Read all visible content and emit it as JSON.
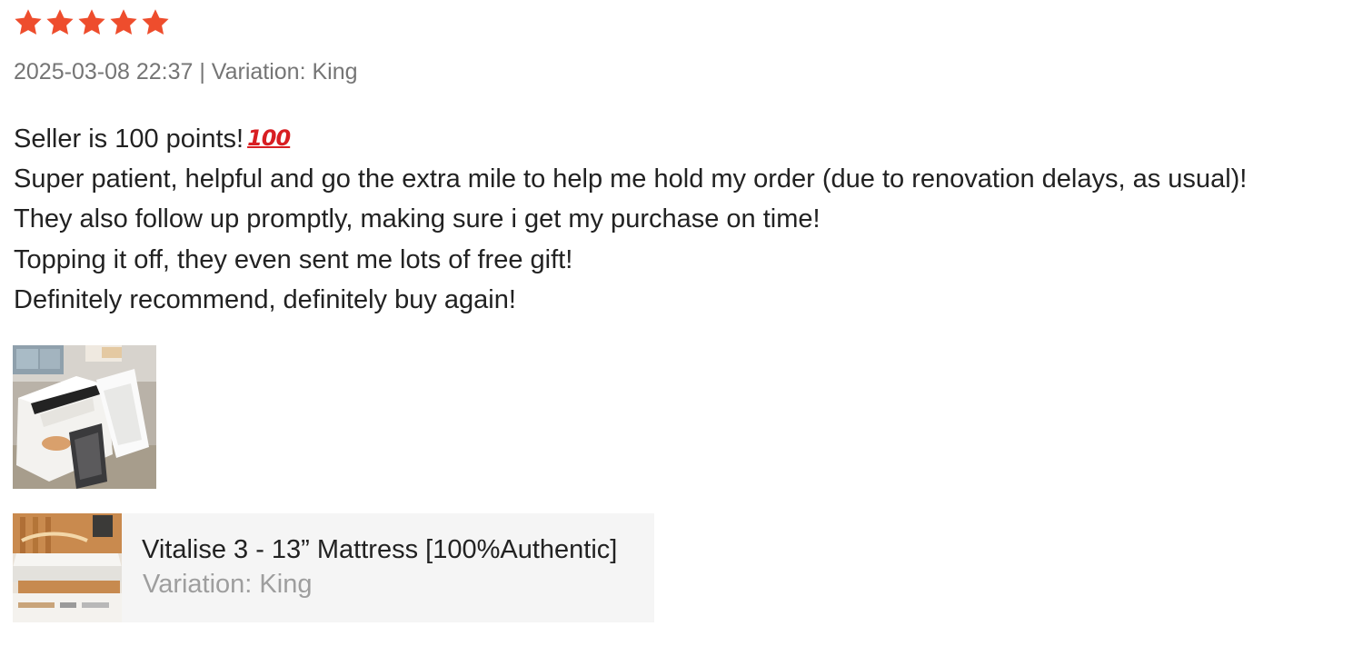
{
  "review": {
    "rating": 5,
    "rating_max": 5,
    "star_color": "#ee4d2d",
    "timestamp": "2025-03-08 22:37",
    "meta_separator": "|",
    "variation_text": "Variation: King",
    "meta_line": "2025-03-08 22:37 | Variation: King",
    "lines": [
      "Seller is 100 points!",
      "Super patient, helpful and go the extra mile to help me hold my order (due to renovation delays, as usual)!",
      "They also follow up promptly, making sure i get my purchase on time!",
      "Topping it off, they even sent me lots of free gift!",
      "Definitely recommend, definitely buy again!"
    ],
    "emoji_text": "100",
    "emoji_icon": "hundred-points-icon"
  },
  "product": {
    "title": "Vitalise 3 - 13” Mattress [100%Authentic]",
    "variation": "Variation: King",
    "card_background": "#f5f5f5"
  }
}
